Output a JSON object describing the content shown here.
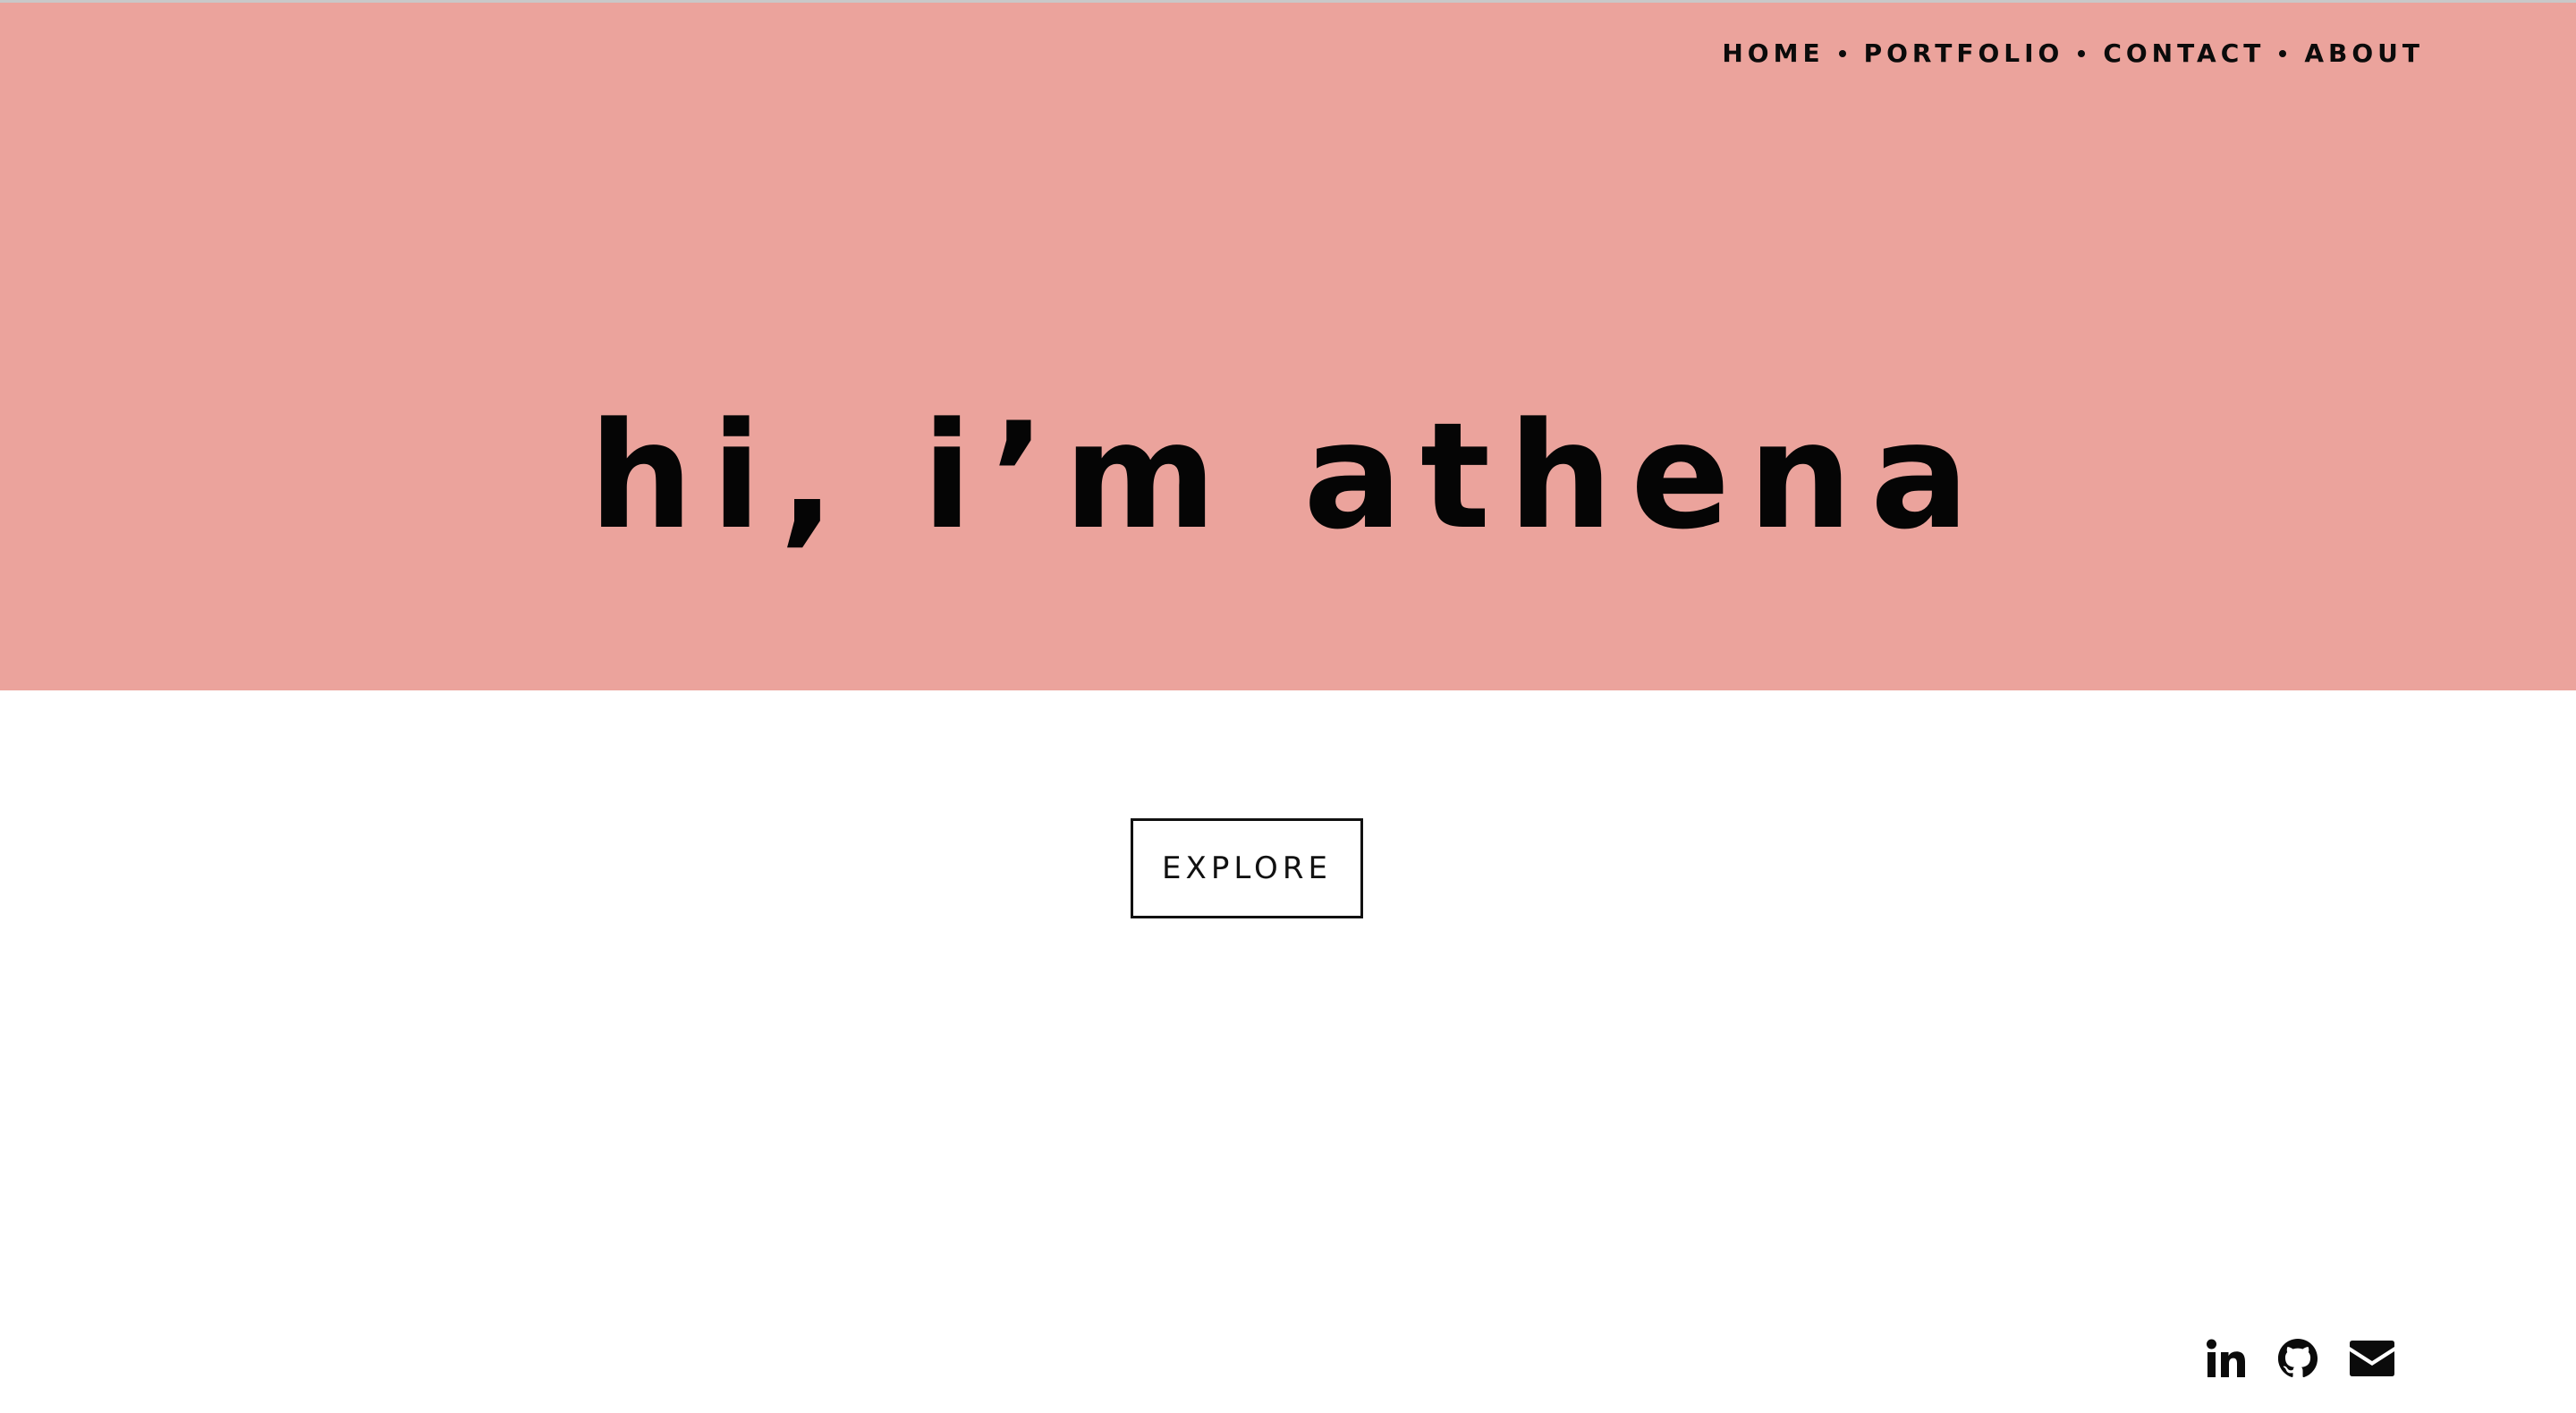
{
  "nav": {
    "items": [
      {
        "label": "HOME"
      },
      {
        "label": "PORTFOLIO"
      },
      {
        "label": "CONTACT"
      },
      {
        "label": "ABOUT"
      }
    ]
  },
  "hero": {
    "title": "hi, i’m athena",
    "background_color": "#eba39c"
  },
  "cta": {
    "label": "EXPLORE"
  },
  "socials": {
    "icons": [
      "linkedin-icon",
      "github-icon",
      "email-icon"
    ]
  }
}
